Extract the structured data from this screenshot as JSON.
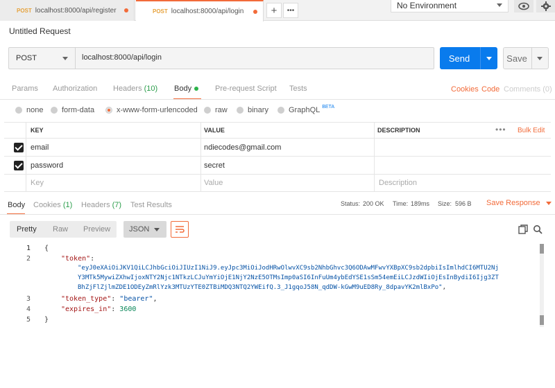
{
  "tabs": [
    {
      "method": "POST",
      "url": "localhost:8000/api/register"
    },
    {
      "method": "POST",
      "url": "localhost:8000/api/login"
    }
  ],
  "environment": "No Environment",
  "request": {
    "title": "Untitled Request",
    "method": "POST",
    "url": "localhost:8000/api/login",
    "send_label": "Send",
    "save_label": "Save"
  },
  "request_tabs": {
    "params": "Params",
    "authorization": "Authorization",
    "headers": "Headers",
    "headers_count": "(10)",
    "body": "Body",
    "prerequest": "Pre-request Script",
    "tests": "Tests",
    "cookies": "Cookies",
    "code": "Code",
    "comments": "Comments (0)"
  },
  "body_types": {
    "none": "none",
    "form_data": "form-data",
    "urlencoded": "x-www-form-urlencoded",
    "raw": "raw",
    "binary": "binary",
    "graphql": "GraphQL",
    "beta": "BETA",
    "selected": "x-www-form-urlencoded"
  },
  "params_table": {
    "headers": {
      "key": "KEY",
      "value": "VALUE",
      "description": "DESCRIPTION"
    },
    "bulk_edit": "Bulk Edit",
    "more": "•••",
    "rows": [
      {
        "key": "email",
        "value": "ndiecodes@gmail.com",
        "checked": true
      },
      {
        "key": "password",
        "value": "secret",
        "checked": true
      }
    ],
    "placeholder": {
      "key": "Key",
      "value": "Value",
      "description": "Description"
    }
  },
  "response_tabs": {
    "body": "Body",
    "cookies": "Cookies",
    "cookies_count": "(1)",
    "headers": "Headers",
    "headers_count": "(7)",
    "test_results": "Test Results"
  },
  "response_meta": {
    "status_label": "Status:",
    "status": "200 OK",
    "time_label": "Time:",
    "time": "189ms",
    "size_label": "Size:",
    "size": "596 B",
    "save_response": "Save Response"
  },
  "response_view": {
    "pretty": "Pretty",
    "raw": "Raw",
    "preview": "Preview",
    "format": "JSON"
  },
  "response_body": {
    "line_numbers": [
      "1",
      "2",
      "",
      "",
      "3",
      "4",
      "5"
    ],
    "open_brace": "{",
    "close_brace": "}",
    "token_key": "\"token\"",
    "token_value_1": "\"eyJ0eXAiOiJKV1QiLCJhbGciOiJIUzI1NiJ9.eyJpc3MiOiJodHRwOlwvXC9sb2NhbGhvc3Q6ODAwMFwvYXBpXC9sb2dpbiIsImlhdCI6MTU2Nj",
    "token_value_2": "Y3MTk5MywiZXhwIjoxNTY2Njc1NTkzLCJuYmYiOjE1NjY2NzE5OTMsImp0aSI6InFuUm4ybEdYSE1sSm54emEiLCJzdWIiOjEsInBydiI6Ijg3ZT",
    "token_value_3": "BhZjFlZjlmZDE1ODEyZmRlYzk3MTUzYTE0ZTBiMDQ3NTQ2YWEifQ.3_J1gqoJ58N_qdDW-kGwM9uED8Ry_8dpavYK2mlBxPo\"",
    "token_type_key": "\"token_type\"",
    "token_type_value": "\"bearer\"",
    "expires_key": "\"expires_in\"",
    "expires_value": "3600"
  },
  "colors": {
    "accent": "#f26b3a",
    "send": "#097bed",
    "success": "#2a9d4a"
  }
}
